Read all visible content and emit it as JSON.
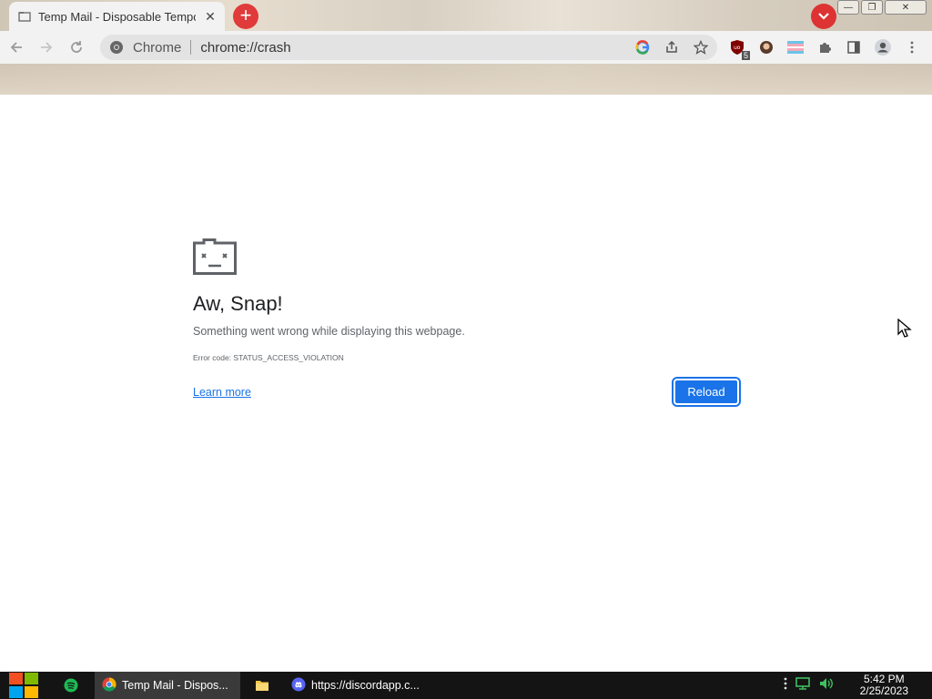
{
  "tab": {
    "title": "Temp Mail - Disposable Temporary Email",
    "close_icon": "close-icon"
  },
  "window_controls": {
    "minimize": "minimize-icon",
    "restore": "restore-icon",
    "close": "close-icon"
  },
  "toolbar": {
    "site_label": "Chrome",
    "url": "chrome://crash",
    "extension_badge": "5"
  },
  "crash": {
    "title": "Aw, Snap!",
    "message": "Something went wrong while displaying this webpage.",
    "error_code": "Error code: STATUS_ACCESS_VIOLATION",
    "learn_more": "Learn more",
    "reload": "Reload"
  },
  "taskbar": {
    "items": [
      {
        "label": "Temp Mail - Dispos...",
        "icon": "chrome-icon"
      },
      {
        "label": "",
        "icon": "folder-icon"
      },
      {
        "label": "https://discordapp.c...",
        "icon": "discord-icon"
      }
    ],
    "time": "5:42 PM",
    "date": "2/25/2023"
  },
  "colors": {
    "accent": "#1a73e8",
    "new_tab": "#e03a3a",
    "taskbar": "#141414"
  }
}
